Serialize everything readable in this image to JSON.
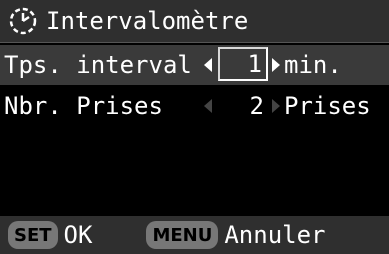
{
  "header": {
    "title": "Intervalomètre",
    "icon": "interval-timer-icon"
  },
  "settings": [
    {
      "label": "Tps. interval",
      "value": "1",
      "unit": "min.",
      "selected": true
    },
    {
      "label": "Nbr. Prises",
      "value": "2",
      "unit": "Prises",
      "selected": false
    }
  ],
  "footer": {
    "set_button": "SET",
    "set_action": "OK",
    "menu_button": "MENU",
    "menu_action": "Annuler"
  },
  "colors": {
    "background": "#000000",
    "bar": "#2f2f2f",
    "selected_row": "#3a3a3a",
    "button": "#777777",
    "text": "#ffffff"
  }
}
